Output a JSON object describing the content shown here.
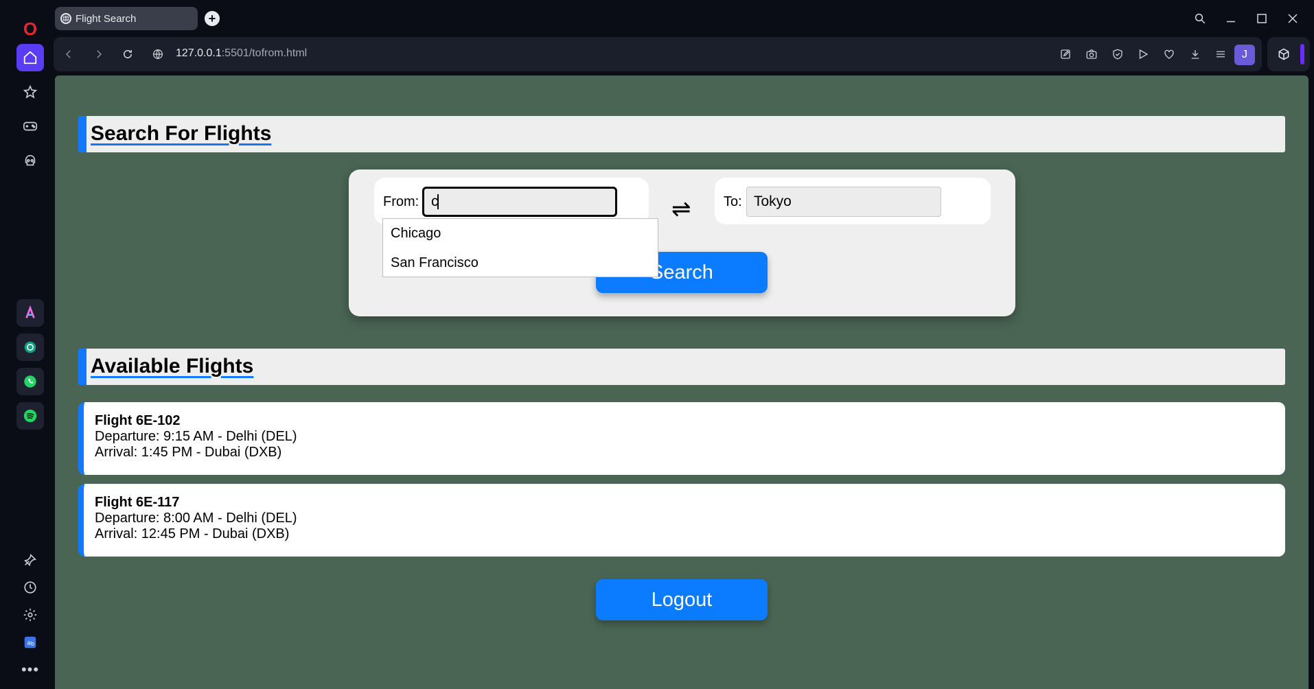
{
  "browser": {
    "tab_title": "Flight Search",
    "url_host": "127.0.0.1",
    "url_rest": ":5501/tofrom.html",
    "profile_initial": "J",
    "sidebar_icons": [
      "opera-logo-icon",
      "home-icon",
      "star-icon",
      "gamepad-icon",
      "skull-icon",
      "aria-icon",
      "chatgpt-icon",
      "whatsapp-icon",
      "spotify-icon",
      "pin-icon",
      "history-icon",
      "settings-icon",
      "translate-icon",
      "more-icon"
    ]
  },
  "page": {
    "search_heading": "Search For Flights",
    "from_label": "From:",
    "from_value": "c",
    "to_label": "To:",
    "to_value": "Tokyo",
    "swap_symbol": "⇌",
    "search_button": "Search",
    "suggestions": [
      "Chicago",
      "San Francisco"
    ],
    "available_heading": "Available Flights",
    "flights": [
      {
        "number": "Flight 6E-102",
        "departure": "Departure: 9:15 AM - Delhi (DEL)",
        "arrival": "Arrival: 1:45 PM - Dubai (DXB)"
      },
      {
        "number": "Flight 6E-117",
        "departure": "Departure: 8:00 AM - Delhi (DEL)",
        "arrival": "Arrival: 12:45 PM - Dubai (DXB)"
      }
    ],
    "logout_button": "Logout"
  },
  "colors": {
    "page_bg": "#4a6554",
    "accent": "#0b7bff",
    "browser_accent": "#5b3cf5"
  }
}
